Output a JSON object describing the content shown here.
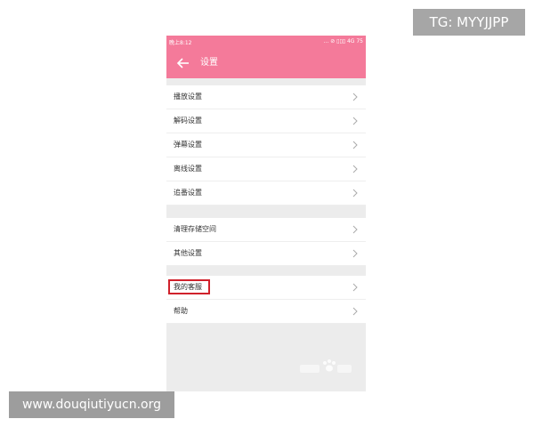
{
  "status_bar": {
    "time": "晚上8:12",
    "icons_text": "... ⊘ ▯▯▯ 4G 75"
  },
  "app_bar": {
    "back_icon": "arrow-left-icon",
    "title": "设置"
  },
  "groups": [
    {
      "items": [
        {
          "label": "播放设置",
          "icon": "chevron-right-icon"
        },
        {
          "label": "解码设置",
          "icon": "chevron-right-icon"
        },
        {
          "label": "弹幕设置",
          "icon": "chevron-right-icon"
        },
        {
          "label": "离线设置",
          "icon": "chevron-right-icon"
        },
        {
          "label": "追番设置",
          "icon": "chevron-right-icon"
        }
      ]
    },
    {
      "items": [
        {
          "label": "清理存储空间",
          "icon": "chevron-right-icon"
        },
        {
          "label": "其他设置",
          "icon": "chevron-right-icon"
        }
      ]
    },
    {
      "items": [
        {
          "label": "我的客服",
          "icon": "chevron-right-icon",
          "highlighted": true
        },
        {
          "label": "帮助",
          "icon": "chevron-right-icon"
        }
      ]
    }
  ],
  "overlays": {
    "tag": "TG: MYYJJPP",
    "url": "www.douqiutiyucn.org"
  },
  "colors": {
    "accent": "#f47a9a",
    "highlight": "#d0212b",
    "background": "#ececec"
  }
}
